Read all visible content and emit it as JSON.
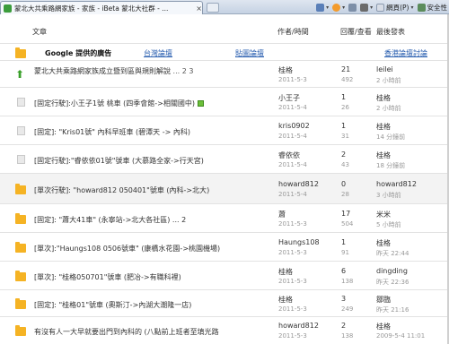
{
  "browser": {
    "tab_title": "蒙北大共乘路網家族 - 家族 - iBeta 蒙北大社群 - ...",
    "tab_close": "×",
    "toolbar": {
      "page_label": "網頁(P)",
      "safety_label": "安全性"
    }
  },
  "table_header": {
    "topic": "文章",
    "author_time": "作者/時間",
    "replies_views": "回覆/查看",
    "last_post": "最後發表"
  },
  "ad_row": {
    "title": "Google 提供的廣告",
    "links": [
      "台灣論壇",
      "貼圖論壇",
      "香港論壇討論"
    ]
  },
  "threads": [
    {
      "icon": "up",
      "title": "蒙北大共乘路網家族成立暨到區與規則解說",
      "pages": "... 2  3",
      "author": "桂格",
      "date": "2011-5-3",
      "replies": "21",
      "views": "492",
      "last_user": "leilei",
      "last_time": "2 小時前",
      "attach": false
    },
    {
      "icon": "doc",
      "title": "[固定行駛]:小王子1號 桃車 (四季會館->相關國中)",
      "pages": "",
      "author": "小王子",
      "date": "2011-5-4",
      "replies": "1",
      "views": "26",
      "last_user": "桂格",
      "last_time": "2 小時前",
      "attach": true
    },
    {
      "icon": "doc",
      "title": "[固定]: \"Kris01號\" 內科早班車 (碧潭天 -> 內科)",
      "pages": "",
      "author": "kris0902",
      "date": "2011-5-4",
      "replies": "1",
      "views": "31",
      "last_user": "桂格",
      "last_time": "14 分鐘前",
      "attach": false
    },
    {
      "icon": "doc",
      "title": "[固定行駛]:\"睿依依01號\"號車 (大慕路全家->行天宮)",
      "pages": "",
      "author": "睿依依",
      "date": "2011-5-4",
      "replies": "2",
      "views": "43",
      "last_user": "桂格",
      "last_time": "18 分鐘前",
      "attach": false
    },
    {
      "icon": "folder",
      "title": "[單次行駛]: \"howard812 050401\"號車 (內科->北大)",
      "pages": "",
      "author": "howard812",
      "date": "2011-5-4",
      "replies": "0",
      "views": "28",
      "last_user": "howard812",
      "last_time": "3 小時前",
      "attach": false,
      "shaded": true
    },
    {
      "icon": "folder",
      "title": "[固定]: \"蕭大41車\" (永寧站->北大各社區) ...  2",
      "pages": "",
      "author": "蕭",
      "date": "2011-5-3",
      "replies": "17",
      "views": "504",
      "last_user": "米米",
      "last_time": "5 小時前",
      "attach": false
    },
    {
      "icon": "folder",
      "title": "[單次]:\"Haungs108 0506號車\" (康橋水花園->桃園機場)",
      "pages": "",
      "author": "Haungs108",
      "date": "2011-5-3",
      "replies": "1",
      "views": "91",
      "last_user": "桂格",
      "last_time": "昨天 22:44",
      "attach": false
    },
    {
      "icon": "folder",
      "title": "[單次]: \"桂格050701\"號車 (肥冶->有職科裡)",
      "pages": "",
      "author": "桂格",
      "date": "2011-5-3",
      "replies": "6",
      "views": "138",
      "last_user": "dingding",
      "last_time": "昨天 22:36",
      "attach": false
    },
    {
      "icon": "folder",
      "title": "[固定]: \"桂格01\"號車 (奧斯汀->內湖大潮隆一店)",
      "pages": "",
      "author": "桂格",
      "date": "2011-5-3",
      "replies": "3",
      "views": "249",
      "last_user": "鄒臨",
      "last_time": "昨天 21:16",
      "attach": false
    },
    {
      "icon": "folder",
      "title": "有沒有人一大早就要出門到內科的 (八點前上班者至填光路",
      "pages": "",
      "author": "howard812",
      "date": "2011-5-3",
      "replies": "2",
      "views": "138",
      "last_user": "桂格",
      "last_time": "2009-5-4 11:01",
      "attach": false
    }
  ]
}
